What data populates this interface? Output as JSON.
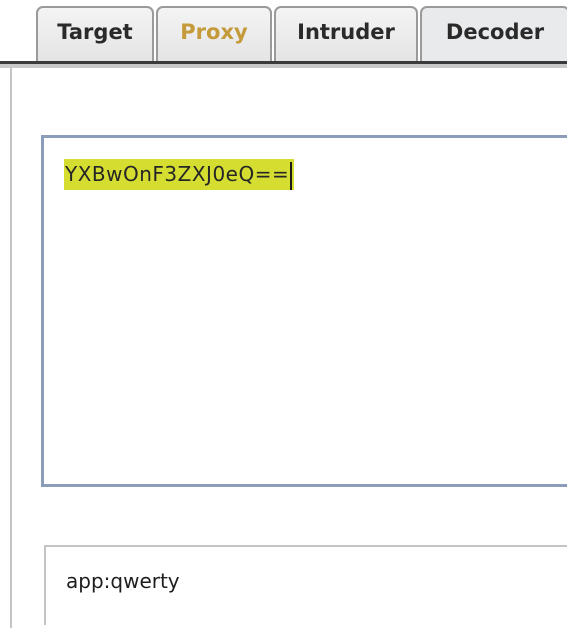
{
  "tabs": [
    {
      "label": "Target",
      "state": "normal"
    },
    {
      "label": "Proxy",
      "state": "highlighted"
    },
    {
      "label": "Intruder",
      "state": "normal"
    },
    {
      "label": "Decoder",
      "state": "active"
    }
  ],
  "colors": {
    "highlighted_tab_text": "#c49a3a",
    "selection_highlight": "#d5dd30",
    "input_border": "#8c9dba",
    "tab_baseline": "#3b3b3b"
  },
  "decoder": {
    "input_value": "YXBwOnF3ZXJ0eQ==",
    "output_value": "app:qwerty"
  }
}
